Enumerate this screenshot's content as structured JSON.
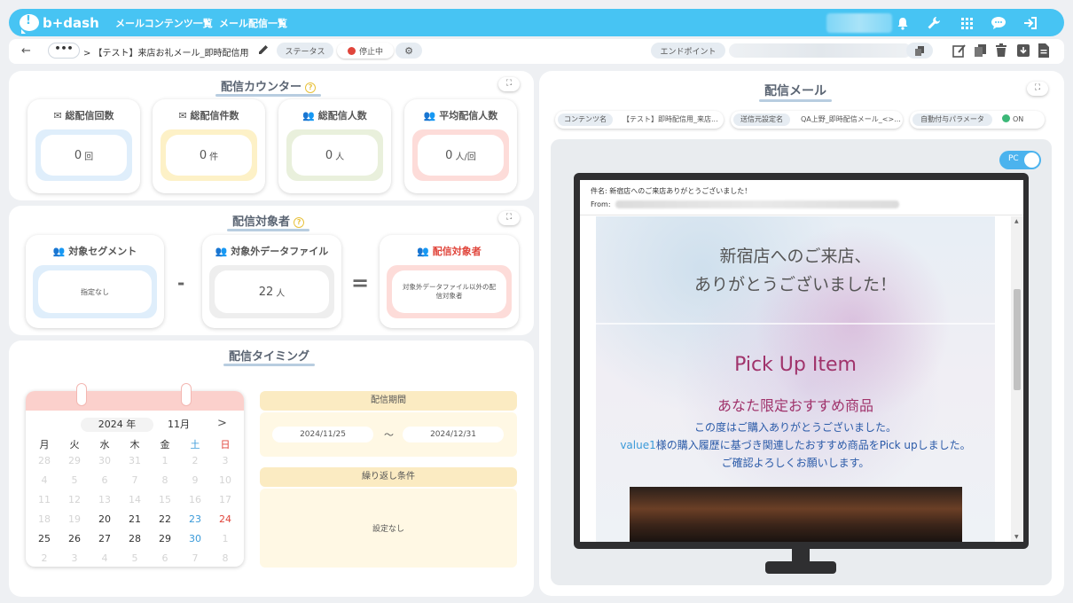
{
  "app": {
    "logo_text": "b+dash",
    "nav": [
      "メールコンテンツ一覧",
      "メール配信一覧"
    ]
  },
  "subbar": {
    "more": "•••",
    "breadcrumb": "> 【テスト】来店お礼メール_即時配信用",
    "status_key": "ステータス",
    "status_value": "停止中",
    "endpoint_key": "エンドポイント"
  },
  "counter": {
    "title": "配信カウンター",
    "cards": [
      {
        "label": "総配信回数",
        "value": "0",
        "unit": "回",
        "icon": "mail-icon"
      },
      {
        "label": "総配信件数",
        "value": "0",
        "unit": "件",
        "icon": "mail-icon"
      },
      {
        "label": "総配信人数",
        "value": "0",
        "unit": "人",
        "icon": "users-icon"
      },
      {
        "label": "平均配信人数",
        "value": "0",
        "unit": "人/回",
        "icon": "users-icon"
      }
    ]
  },
  "target": {
    "title": "配信対象者",
    "segment_label": "対象セグメント",
    "segment_value": "指定なし",
    "minus": "-",
    "excluded_label": "対象外データファイル",
    "excluded_value": "22",
    "excluded_unit": "人",
    "equals": "=",
    "result_label": "配信対象者",
    "result_value": "対象外データファイル以外の配信対象者"
  },
  "timing": {
    "title": "配信タイミング",
    "calendar": {
      "year": "2024 年",
      "month": "11月",
      "next": ">",
      "weekdays": [
        "月",
        "火",
        "水",
        "木",
        "金",
        "土",
        "日"
      ],
      "rows": [
        [
          "28",
          "29",
          "30",
          "31",
          "1",
          "2",
          "3"
        ],
        [
          "4",
          "5",
          "6",
          "7",
          "8",
          "9",
          "10"
        ],
        [
          "11",
          "12",
          "13",
          "14",
          "15",
          "16",
          "17"
        ],
        [
          "18",
          "19",
          "20",
          "21",
          "22",
          "23",
          "24"
        ],
        [
          "25",
          "26",
          "27",
          "28",
          "29",
          "30",
          "1"
        ],
        [
          "2",
          "3",
          "4",
          "5",
          "6",
          "7",
          "8"
        ]
      ]
    },
    "period_label": "配信期間",
    "period_start": "2024/11/25",
    "period_sep": "〜",
    "period_end": "2024/12/31",
    "repeat_label": "繰り返し条件",
    "repeat_value": "設定なし"
  },
  "mail": {
    "title": "配信メール",
    "content_key": "コンテンツ名",
    "content_value": "【テスト】即時配信用_来店...",
    "sender_key": "送信元設定名",
    "sender_value": "QA上野_即時配信メール_<>...",
    "param_key": "自動付与パラメータ",
    "param_value": "ON",
    "pc_toggle": "PC",
    "subject": "件名: 新宿店へのご来店ありがとうございました！",
    "from": "From:",
    "hero_line1": "新宿店へのご来店、",
    "hero_line2": "ありがとうございました！",
    "pickup_title": "Pick Up Item",
    "pickup_sub": "あなた限定おすすめ商品",
    "body_line1": "この度はご購入ありがとうございました。",
    "body_line2_var": "value1",
    "body_line2": "様の購入履歴に基づき関連したおすすめ商品をPick upしました。",
    "body_line3": "ご確認よろしくお願いします。"
  },
  "colors": {
    "topbar": "#47c4f3",
    "blue_well": "#dfeefb",
    "yellow_well": "#fdf1c7",
    "green_well": "#e9f0dc",
    "pink_well": "#fddcd9",
    "saturday": "#3a9ad9",
    "sunday": "#e0453b",
    "pickup": "#a0336b"
  }
}
